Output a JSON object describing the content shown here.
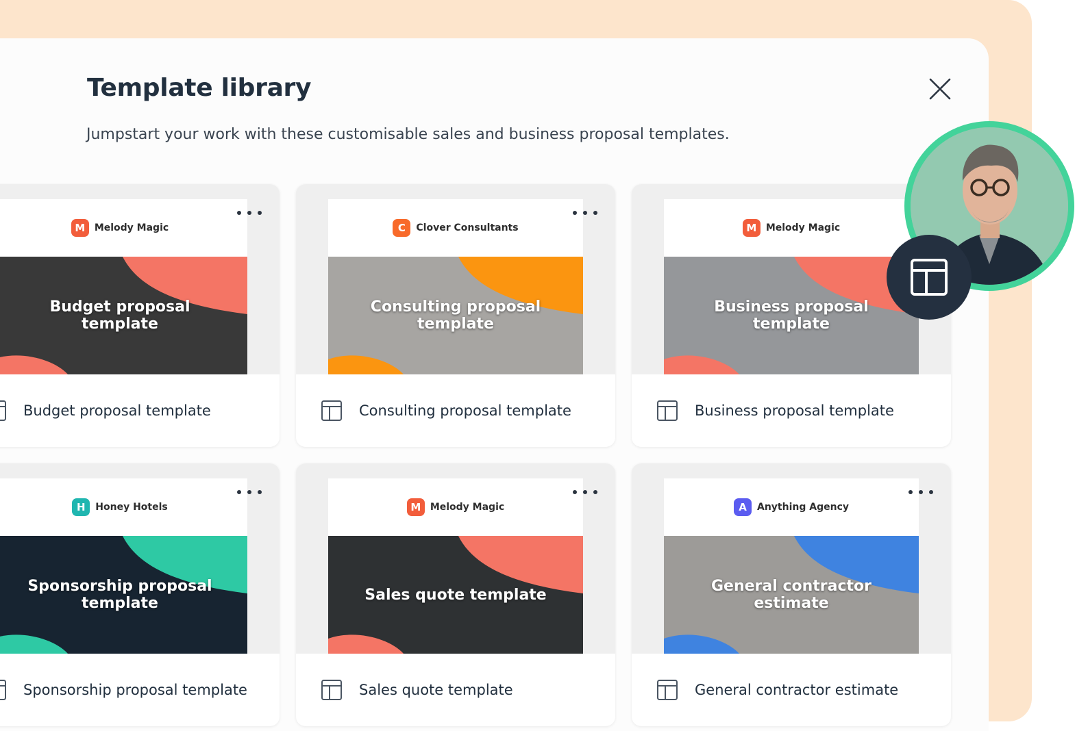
{
  "modal": {
    "title": "Template library",
    "subtitle": "Jumpstart your work with these customisable sales and business proposal templates.",
    "close_icon": "close-icon"
  },
  "templates": [
    {
      "brand": "Melody Magic",
      "logo_color": "#f25d3b",
      "hero_title": "Budget proposal template",
      "accent": "#f47565",
      "photo": "#4a4a4a",
      "label": "Budget proposal template"
    },
    {
      "brand": "Clover Consultants",
      "logo_color": "#f86a2a",
      "hero_title": "Consulting proposal template",
      "accent": "#fb9510",
      "photo": "#d6d4d0",
      "label": "Consulting proposal template"
    },
    {
      "brand": "Melody Magic",
      "logo_color": "#f25d3b",
      "hero_title": "Business proposal template",
      "accent": "#f47565",
      "photo": "#bfc2c6",
      "label": "Business proposal template"
    },
    {
      "brand": "Honey Hotels",
      "logo_color": "#20b6b0",
      "hero_title": "Sponsorship proposal template",
      "accent": "#2ec9a4",
      "photo": "#1e2f3f",
      "label": "Sponsorship proposal template"
    },
    {
      "brand": "Melody Magic",
      "logo_color": "#f25d3b",
      "hero_title": "Sales quote template",
      "accent": "#f47565",
      "photo": "#3c3f42",
      "label": "Sales quote template"
    },
    {
      "brand": "Anything Agency",
      "logo_color": "#5b5cf0",
      "hero_title": "General contractor estimate",
      "accent": "#3f83e0",
      "photo": "#c9c7c3",
      "label": "General contractor estimate"
    }
  ],
  "icons": {
    "more": "more-horizontal-icon",
    "template": "template-layout-icon",
    "badge": "template-layout-icon"
  },
  "colors": {
    "background_panel": "#fde5cc",
    "avatar_ring": "#43d39a",
    "badge": "#243040",
    "text": "#22303f"
  }
}
